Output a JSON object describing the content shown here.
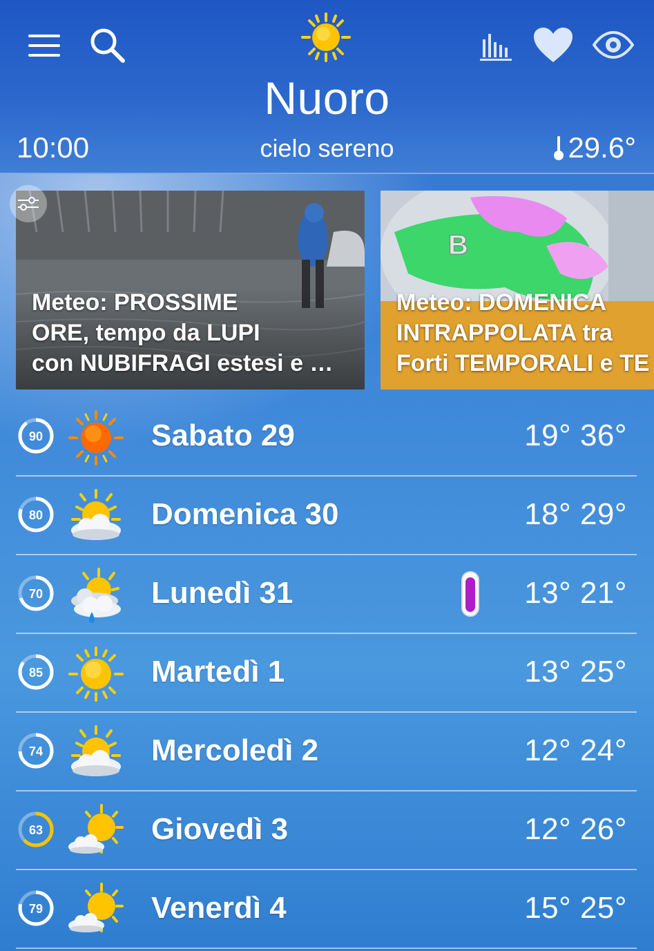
{
  "header": {
    "city": "Nuoro",
    "time": "10:00",
    "condition": "cielo sereno",
    "temperature": "29.6°",
    "icons": [
      "menu-icon",
      "search-icon",
      "sun-icon",
      "chart-icon",
      "heart-icon",
      "eye-icon"
    ]
  },
  "news": [
    {
      "title": "Meteo: PROSSIME\nORE, tempo da LUPI\ncon NUBIFRAGI estesi e …"
    },
    {
      "title": "Meteo:  DOMENICA\nINTRAPPOLATA tra\nForti TEMPORALI e TE"
    }
  ],
  "forecast": [
    {
      "score": 90,
      "day": "Sabato 29",
      "temps": "19° 36°",
      "icon": "sun-hot-icon",
      "score_color": "#ffffff"
    },
    {
      "score": 80,
      "day": "Domenica 30",
      "temps": "18° 29°",
      "icon": "sun-cloud-icon",
      "score_color": "#ffffff"
    },
    {
      "score": 70,
      "day": "Lunedì 31",
      "temps": "13° 21°",
      "icon": "sun-cloud-rain-icon",
      "score_color": "#ffffff",
      "alert": "thermometer-purple-icon"
    },
    {
      "score": 85,
      "day": "Martedì 1",
      "temps": "13° 25°",
      "icon": "sun-icon",
      "score_color": "#ffffff"
    },
    {
      "score": 74,
      "day": "Mercoledì 2",
      "temps": "12° 24°",
      "icon": "sun-cloud-icon",
      "score_color": "#ffffff"
    },
    {
      "score": 63,
      "day": "Giovedì 3",
      "temps": "12° 26°",
      "icon": "sun-small-cloud-icon",
      "score_color": "#f5c400"
    },
    {
      "score": 79,
      "day": "Venerdì 4",
      "temps": "15° 25°",
      "icon": "sun-small-cloud-icon",
      "score_color": "#ffffff"
    }
  ],
  "colors": {
    "header_bg": "#2b67cc",
    "sun_yellow": "#ffcc00",
    "sun_orange": "#ff6a00",
    "thermo_purple": "#b01cc9"
  }
}
